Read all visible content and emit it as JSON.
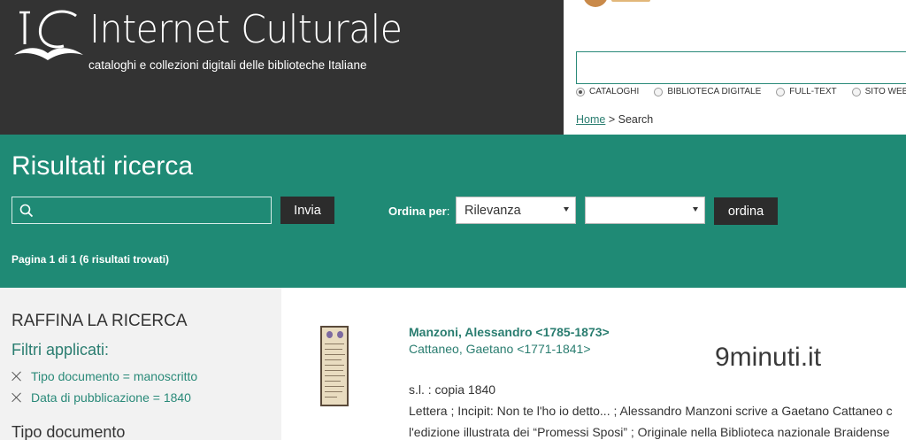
{
  "header": {
    "site_title": "Internet Culturale",
    "subtitle": "cataloghi e collezioni digitali delle biblioteche Italiane",
    "search_placeholder": "",
    "search_scopes": [
      {
        "label": "CATALOGHI",
        "selected": true
      },
      {
        "label": "BIBLIOTECA DIGITALE",
        "selected": false
      },
      {
        "label": "FULL-TEXT",
        "selected": false
      },
      {
        "label": "SITO WEB",
        "selected": false
      }
    ]
  },
  "breadcrumb": {
    "home": "Home",
    "separator": ">",
    "current": "Search"
  },
  "results_header": {
    "title": "Risultati ricerca",
    "search_value": "",
    "submit_label": "Invia",
    "sort_label": "Ordina per",
    "sort_colon": ":",
    "sort_primary": "Rilevanza",
    "sort_secondary": "",
    "sort_button": "ordina",
    "pagination": "Pagina 1 di 1 (6 risultati trovati)"
  },
  "sidebar": {
    "title": "RAFFINA LA RICERCA",
    "applied_filters_title": "Filtri applicati:",
    "filters": [
      "Tipo documento = manoscritto",
      "Data di pubblicazione = 1840"
    ],
    "next_section_title": "Tipo documento"
  },
  "results": [
    {
      "author": "Manzoni, Alessandro <1785-1873>",
      "coauthor": "Cattaneo, Gaetano <1771-1841>",
      "place_date": "s.l. : copia 1840",
      "description_line1": "Lettera ; Incipit: Non te l'ho io detto... ; Alessandro Manzoni scrive a Gaetano Cattaneo c",
      "description_line2": "l'edizione illustrata dei “Promessi Sposi” ; Originale nella Biblioteca nazionale Braidense"
    }
  ],
  "watermark": "9minuti.it",
  "colors": {
    "header_dark": "#333333",
    "teal": "#1f8a75",
    "link": "#2a7d70",
    "sidebar_bg": "#f2f2f2",
    "button_dark": "#2c2c2c"
  }
}
